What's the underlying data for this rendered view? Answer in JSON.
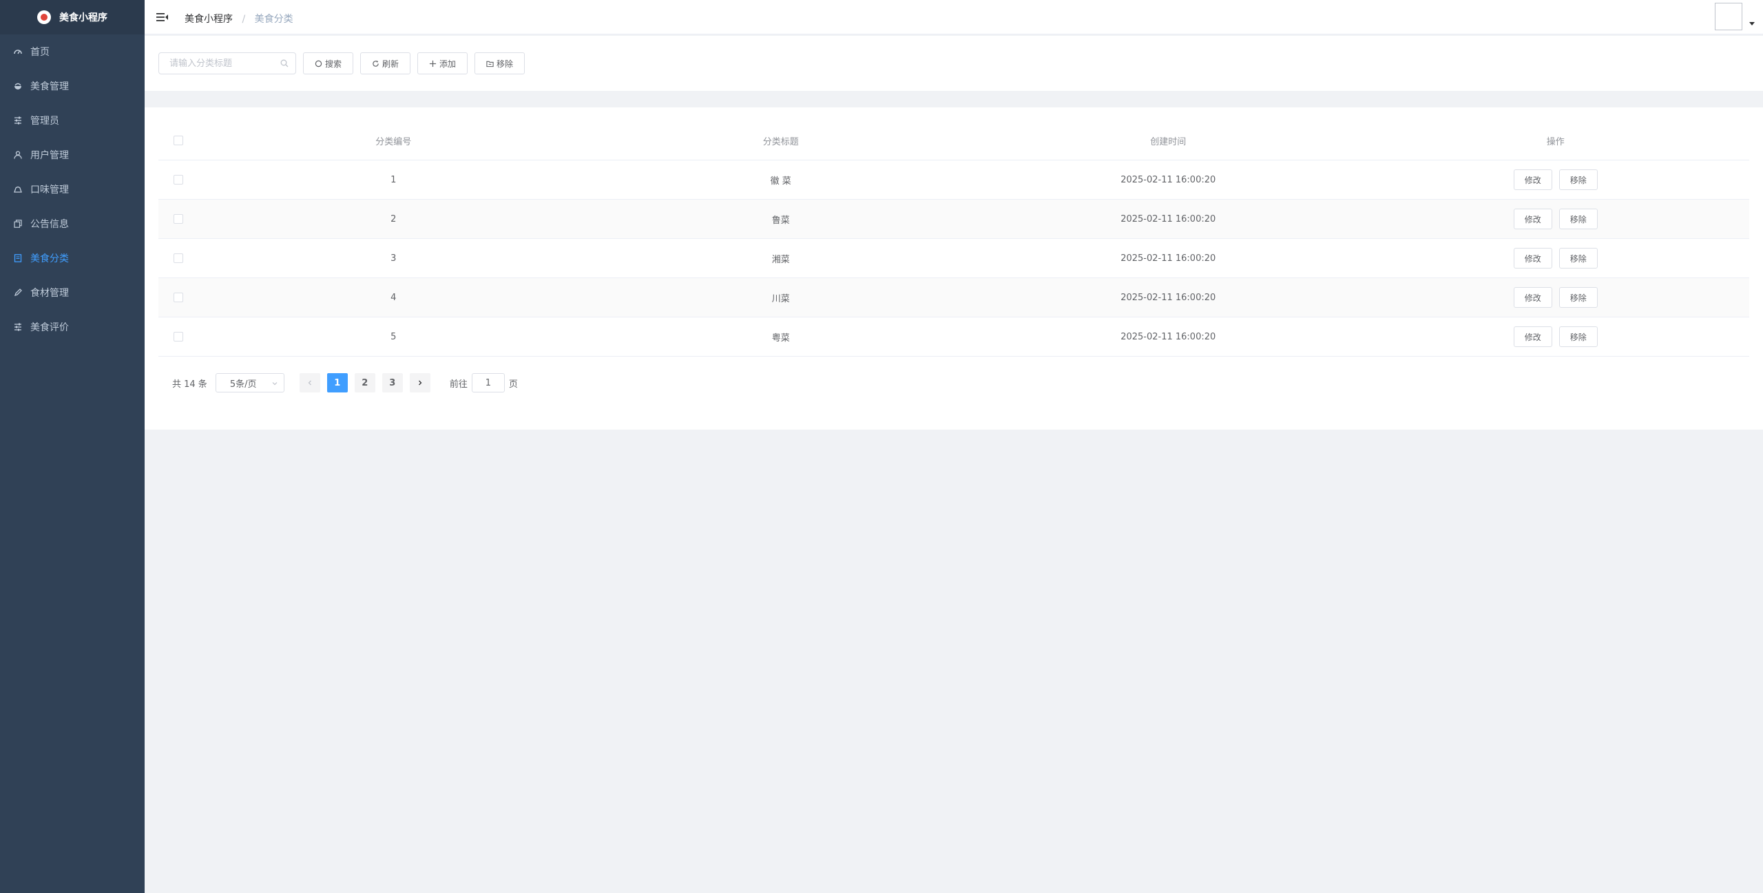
{
  "app": {
    "title": "美食小程序"
  },
  "sidebar": {
    "items": [
      {
        "label": "首页",
        "icon": "dashboard-icon",
        "active": false
      },
      {
        "label": "美食管理",
        "icon": "food-icon",
        "active": false
      },
      {
        "label": "管理员",
        "icon": "sliders-icon",
        "active": false
      },
      {
        "label": "用户管理",
        "icon": "user-icon",
        "active": false
      },
      {
        "label": "口味管理",
        "icon": "taste-icon",
        "active": false
      },
      {
        "label": "公告信息",
        "icon": "copy-icon",
        "active": false
      },
      {
        "label": "美食分类",
        "icon": "document-icon",
        "active": true
      },
      {
        "label": "食材管理",
        "icon": "edit-icon",
        "active": false
      },
      {
        "label": "美食评价",
        "icon": "sliders-icon",
        "active": false
      }
    ]
  },
  "breadcrumb": {
    "home": "美食小程序",
    "separator": "/",
    "current": "美食分类"
  },
  "toolbar": {
    "search_placeholder": "请输入分类标题",
    "search_label": "搜索",
    "refresh_label": "刷新",
    "add_label": "添加",
    "remove_label": "移除"
  },
  "table": {
    "columns": [
      "分类编号",
      "分类标题",
      "创建时间",
      "操作"
    ],
    "rows": [
      {
        "id": "1",
        "title": "徽 菜",
        "created": "2025-02-11 16:00:20"
      },
      {
        "id": "2",
        "title": "鲁菜",
        "created": "2025-02-11 16:00:20"
      },
      {
        "id": "3",
        "title": "湘菜",
        "created": "2025-02-11 16:00:20"
      },
      {
        "id": "4",
        "title": "川菜",
        "created": "2025-02-11 16:00:20"
      },
      {
        "id": "5",
        "title": "粤菜",
        "created": "2025-02-11 16:00:20"
      }
    ],
    "edit_label": "修改",
    "delete_label": "移除"
  },
  "pagination": {
    "total_text": "共 14 条",
    "page_size": "5条/页",
    "pages": [
      "1",
      "2",
      "3"
    ],
    "current_page": "1",
    "goto_prefix": "前往",
    "goto_value": "1",
    "goto_suffix": "页"
  },
  "colors": {
    "sidebar_bg": "#304156",
    "accent": "#409eff",
    "menu_text": "#bfcbd9"
  }
}
